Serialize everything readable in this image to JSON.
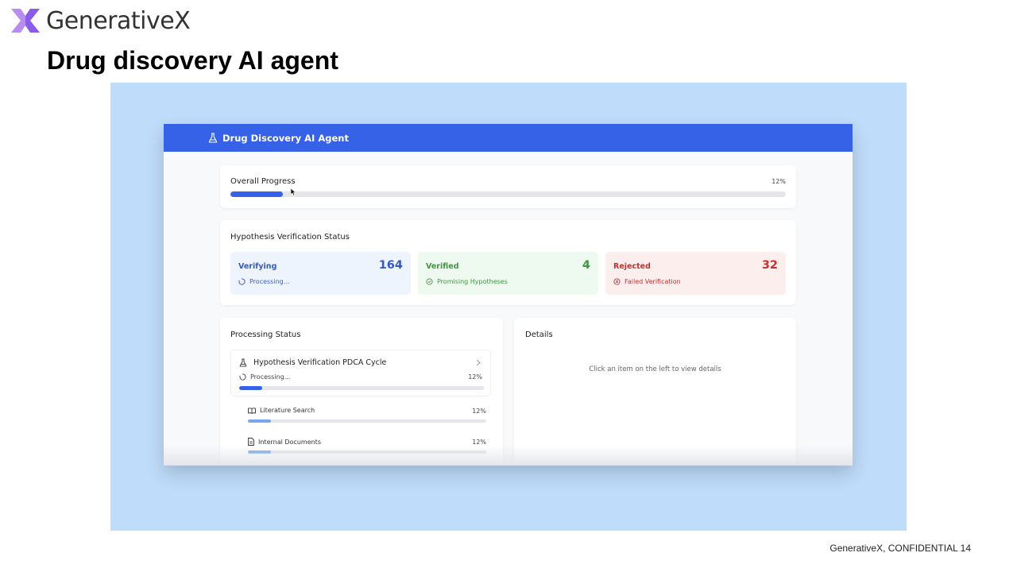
{
  "slide": {
    "brand": "GenerativeX",
    "title": "Drug discovery AI agent",
    "footer": "GenerativeX, CONFIDENTIAL 14"
  },
  "colors": {
    "frame_bg": "#bfdcfb",
    "header_blue": "#3562e6",
    "progress_fill": "#3562e6",
    "verifying": "#3559c7",
    "verified": "#3a9a3e",
    "rejected": "#c53030"
  },
  "app": {
    "title": "Drug Discovery AI Agent",
    "title_icon": "flask-icon",
    "overall_progress": {
      "label": "Overall Progress",
      "percent_text": "12%",
      "fraction": 0.095
    },
    "hypothesis": {
      "title": "Hypothesis Verification Status",
      "stats": [
        {
          "label": "Verifying",
          "count": "164",
          "sub": "Processing...",
          "icon": "spinner-icon"
        },
        {
          "label": "Verified",
          "count": "4",
          "sub": "Promising Hypotheses",
          "icon": "check-circle-icon"
        },
        {
          "label": "Rejected",
          "count": "32",
          "sub": "Failed Verification",
          "icon": "x-circle-icon"
        }
      ]
    },
    "processing": {
      "title": "Processing Status",
      "cycle": {
        "label": "Hypothesis Verification PDCA Cycle",
        "status": "Processing...",
        "percent_text": "12%",
        "fraction": 0.095
      },
      "items": [
        {
          "label": "Literature Search",
          "percent_text": "12%",
          "fraction": 0.095,
          "icon": "book-icon"
        },
        {
          "label": "Internal Documents",
          "percent_text": "12%",
          "fraction": 0.095,
          "icon": "document-icon"
        }
      ]
    },
    "details": {
      "title": "Details",
      "hint": "Click an item on the left to view details"
    }
  }
}
